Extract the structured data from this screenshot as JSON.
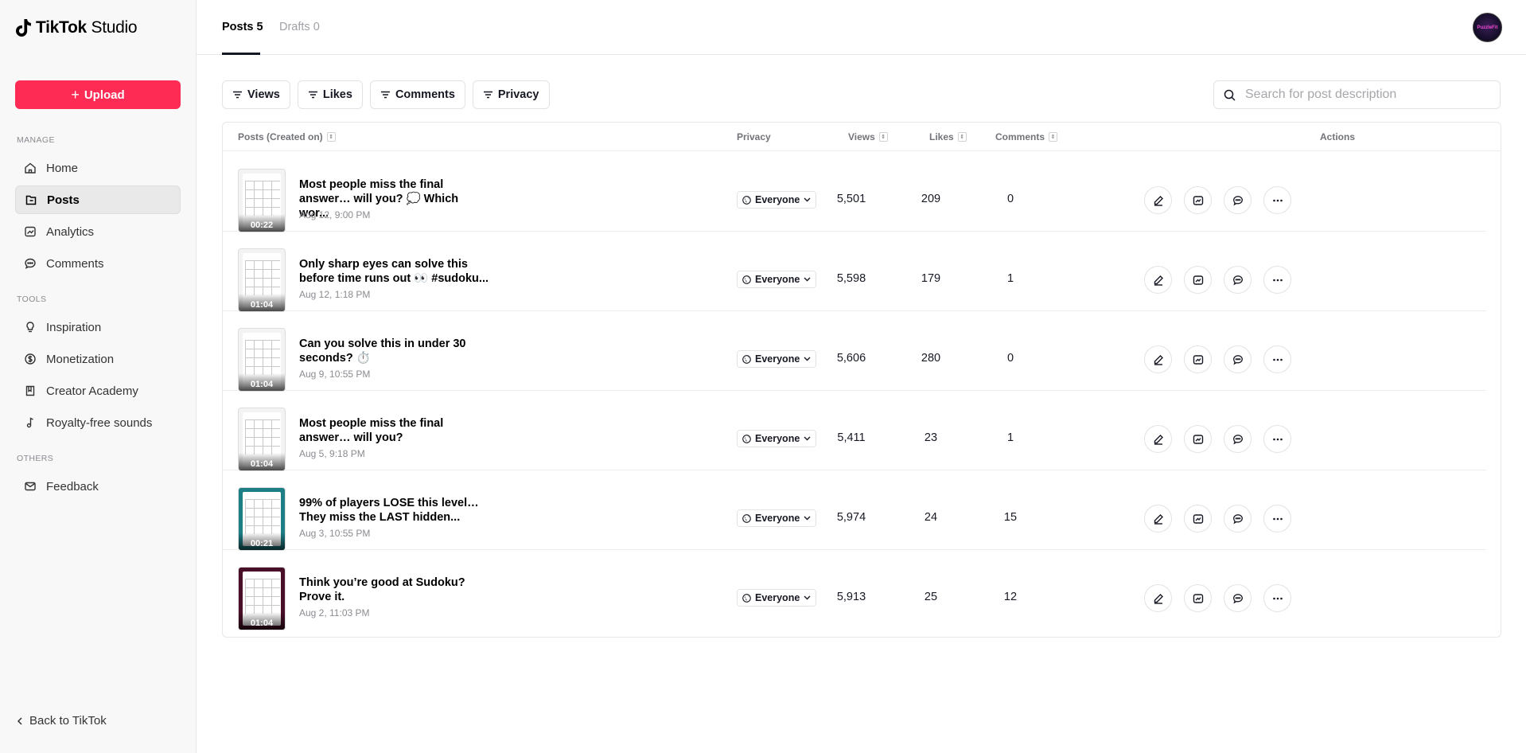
{
  "app": {
    "logo_bold": "TikTok",
    "logo_light": " Studio"
  },
  "sidebar": {
    "upload_label": "Upload",
    "sections": {
      "manage": "MANAGE",
      "tools": "TOOLS",
      "others": "OTHERS"
    },
    "items": [
      {
        "label": "Home",
        "icon": "home-icon"
      },
      {
        "label": "Posts",
        "icon": "posts-icon",
        "active": true
      },
      {
        "label": "Analytics",
        "icon": "analytics-icon"
      },
      {
        "label": "Comments",
        "icon": "comments-icon"
      },
      {
        "label": "Inspiration",
        "icon": "lightbulb-icon"
      },
      {
        "label": "Monetization",
        "icon": "dollar-icon"
      },
      {
        "label": "Creator Academy",
        "icon": "book-icon"
      },
      {
        "label": "Royalty-free sounds",
        "icon": "music-icon"
      },
      {
        "label": "Feedback",
        "icon": "mail-icon"
      }
    ],
    "back_label": "Back to TikTok"
  },
  "tabs": [
    {
      "label": "Posts 5",
      "active": true
    },
    {
      "label": "Drafts 0",
      "active": false
    }
  ],
  "avatar_text": "PuzzleFit",
  "filters": [
    "Views",
    "Likes",
    "Comments",
    "Privacy"
  ],
  "search": {
    "placeholder": "Search for post description",
    "value": ""
  },
  "table": {
    "headers": {
      "posts": "Posts (Created on)",
      "privacy": "Privacy",
      "views": "Views",
      "likes": "Likes",
      "comments": "Comments",
      "actions": "Actions"
    },
    "rows": [
      {
        "title": "Most people miss the final answer… will you? 💭 Which wor...",
        "date": "Aug 12, 9:00 PM",
        "duration": "00:22",
        "privacy": "Everyone",
        "views": "5,501",
        "likes": "209",
        "comments": "0",
        "thumb": "light"
      },
      {
        "title": "Only sharp eyes can solve this before time runs out 👀 #sudoku...",
        "date": "Aug 12, 1:18 PM",
        "duration": "01:04",
        "privacy": "Everyone",
        "views": "5,598",
        "likes": "179",
        "comments": "1",
        "thumb": "light"
      },
      {
        "title": "Can you solve this in under 30 seconds? ⏱️",
        "date": "Aug 9, 10:55 PM",
        "duration": "01:04",
        "privacy": "Everyone",
        "views": "5,606",
        "likes": "280",
        "comments": "0",
        "thumb": "light"
      },
      {
        "title": "Most people miss the final answer… will you?",
        "date": "Aug 5, 9:18 PM",
        "duration": "01:04",
        "privacy": "Everyone",
        "views": "5,411",
        "likes": "23",
        "comments": "1",
        "thumb": "light"
      },
      {
        "title": "99% of players LOSE this level… They miss the LAST hidden...",
        "date": "Aug 3, 10:55 PM",
        "duration": "00:21",
        "privacy": "Everyone",
        "views": "5,974",
        "likes": "24",
        "comments": "15",
        "thumb": "teal"
      },
      {
        "title": "Think you’re good at Sudoku? Prove it.",
        "date": "Aug 2, 11:03 PM",
        "duration": "01:04",
        "privacy": "Everyone",
        "views": "5,913",
        "likes": "25",
        "comments": "12",
        "thumb": "maroon"
      }
    ]
  },
  "colors": {
    "accent": "#fe2c55",
    "text": "#161823",
    "muted": "#8a8b91"
  }
}
